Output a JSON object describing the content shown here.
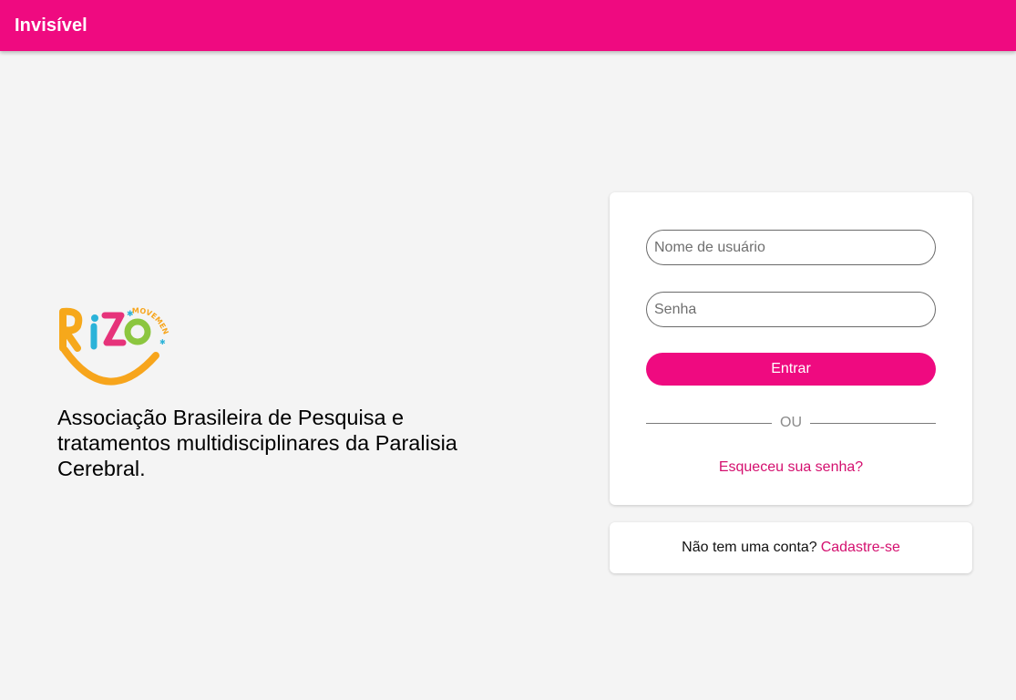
{
  "app": {
    "title": "Invisível",
    "brand_color": "#ef0a80",
    "link_color": "#d4106f"
  },
  "hero": {
    "logo_icon": "rizo-movement-logo",
    "logo_text": "RiZO MOVEMENT",
    "tagline": "Associação Brasileira de Pesquisa e tratamentos multidisciplinares da Paralisia Cerebral."
  },
  "login": {
    "username_placeholder": "Nome de usuário",
    "password_placeholder": "Senha",
    "submit_label": "Entrar",
    "divider_label": "OU",
    "forgot_label": "Esqueceu sua senha?"
  },
  "signup": {
    "prompt": "Não tem uma conta?",
    "link_label": "Cadastre-se"
  }
}
